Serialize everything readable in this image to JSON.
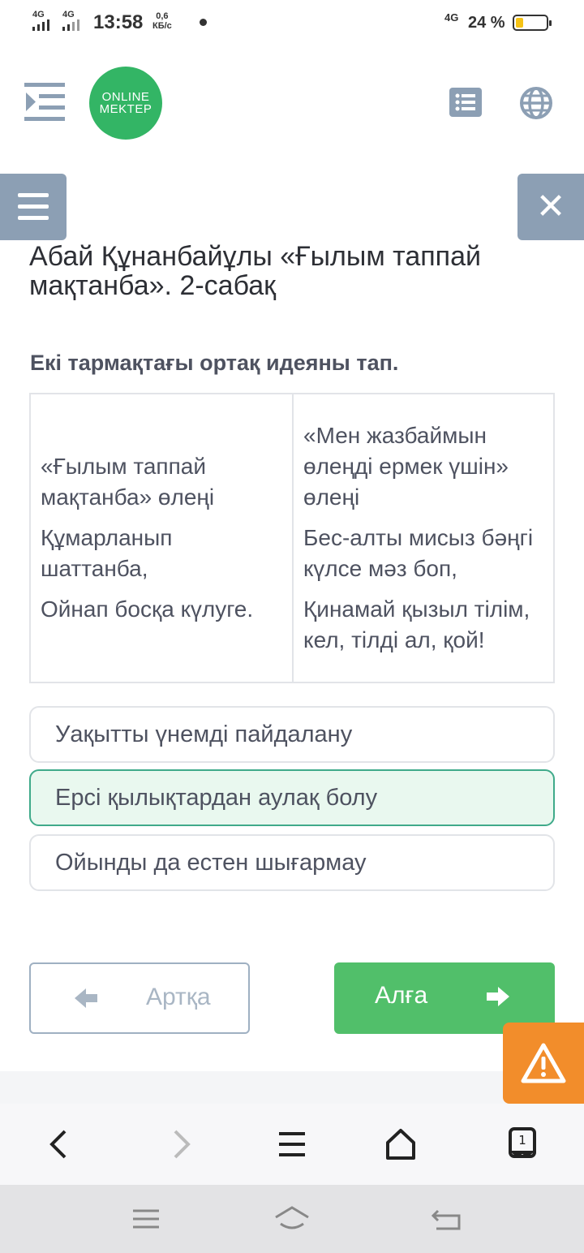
{
  "status_bar": {
    "signal1": "4G",
    "signal2": "4G",
    "time": "13:58",
    "speed_value": "0,6",
    "speed_unit": "КБ/с",
    "network": "4G",
    "battery": "24 %",
    "battery_level": 0.24,
    "battery_color": "#f6c315"
  },
  "header": {
    "logo_line1": "ONLINE",
    "logo_line2": "MEKTEP",
    "logo_color": "#33b565",
    "icons": [
      "indent-icon",
      "list-icon",
      "globe-icon"
    ]
  },
  "lesson": {
    "title": "Абай Құнанбайұлы «Ғылым таппай мақтанба». 2-сабақ",
    "question": "Екі тармақтағы ортақ идеяны тап."
  },
  "table": {
    "left": {
      "heading": "«Ғылым таппай мақтанба» өлеңі",
      "line1": "Құмарланып шаттанба,",
      "line2": "Ойнап босқа күлуге."
    },
    "right": {
      "heading": "«Мен жазбаймын өлеңді ермек үшін» өлеңі",
      "line1": "Бес-алты мисыз бәңгі күлсе мәз боп,",
      "line2": "Қинамай қызыл тілім, кел, тілді ал, қой!"
    }
  },
  "options": [
    {
      "label": "Уақытты үнемді пайдалану",
      "selected": false
    },
    {
      "label": "Ерсі қылықтардан аулақ болу",
      "selected": true
    },
    {
      "label": "Ойынды да естен шығармау",
      "selected": false
    }
  ],
  "nav": {
    "back_label": "Артқа",
    "next_label": "Алға",
    "next_color": "#51bf6a"
  },
  "report_button": {
    "icon": "warning-icon",
    "color": "#f28d2b"
  },
  "browser_nav": {
    "icons": [
      "back-icon",
      "forward-icon",
      "menu-icon",
      "home-icon",
      "tabs-icon"
    ],
    "tabs_count": "1"
  },
  "system_nav": {
    "icons": [
      "recents-icon",
      "home-icon",
      "back-icon"
    ]
  }
}
